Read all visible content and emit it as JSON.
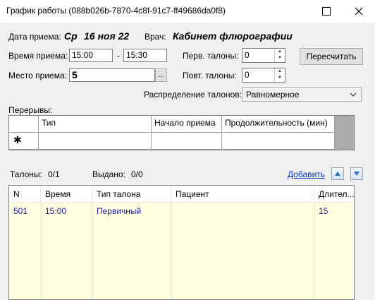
{
  "window": {
    "title": "График работы (088b026b-7870-4c8f-91c7-ff49686da0f8)"
  },
  "header": {
    "date_label": "Дата приема:",
    "date_weekday": "Ср",
    "date_value": "16 ноя 22",
    "doctor_label": "Врач:",
    "doctor_value": "Кабинет флюрографии"
  },
  "form": {
    "time_label": "Время приема:",
    "time_from": "15:00",
    "time_dash": "-",
    "time_to": "15:30",
    "place_label": "Место приема:",
    "place_value": "5",
    "browse_label": "...",
    "first_tickets_label": "Перв. талоны:",
    "first_tickets_value": "0",
    "repeat_tickets_label": "Повт. талоны:",
    "repeat_tickets_value": "0",
    "recalc_button": "Пересчитать",
    "distribution_label": "Распределение талонов:",
    "distribution_value": "Равномерное"
  },
  "breaks": {
    "label": "Перерывы:",
    "columns": [
      "Тип",
      "Начало приема",
      "Продолжительность (мин)"
    ],
    "new_row_marker": "✱"
  },
  "tickets": {
    "count_label": "Талоны:",
    "count_value": "0/1",
    "issued_label": "Выдано:",
    "issued_value": "0/0",
    "add_link": "Добавить"
  },
  "list": {
    "columns": [
      "N",
      "Время",
      "Тип талона",
      "Пациент",
      "Длител..."
    ],
    "rows": [
      {
        "n": "501",
        "time": "15:00",
        "type": "Первичный",
        "patient": "",
        "duration": "15"
      }
    ]
  },
  "icons": {
    "close": "close-icon",
    "maximize": "maximize-icon",
    "move_up": "arrow-up-icon",
    "move_down": "arrow-down-icon"
  },
  "colors": {
    "list_bg": "#ffffe1",
    "list_text": "#1a1aa8",
    "link": "#0033cc"
  }
}
